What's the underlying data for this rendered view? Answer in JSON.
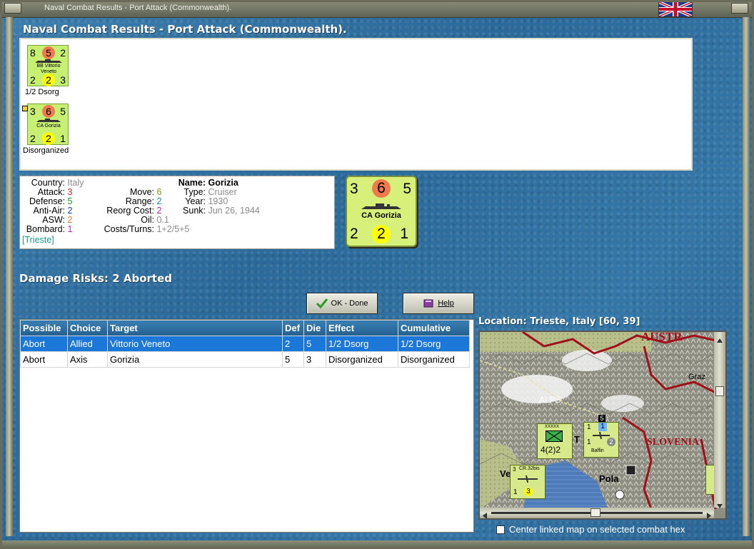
{
  "window": {
    "title": "Naval Combat Results - Port Attack (Commonwealth)."
  },
  "heading": "Naval Combat Results - Port Attack (Commonwealth).",
  "units": [
    {
      "attack_top_left": "8",
      "center_top": "5",
      "top_right": "2",
      "name_line1": "BB Vittorio",
      "name_line2": "Veneto",
      "bottom_left": "2",
      "center_bottom": "2",
      "bottom_right": "3",
      "status": "1/2 Dsorg"
    },
    {
      "attack_top_left": "3",
      "center_top": "6",
      "top_right": "5",
      "name_line1": "CA Gorizia",
      "name_line2": "",
      "bottom_left": "2",
      "center_bottom": "2",
      "bottom_right": "1",
      "status": "Disorganized"
    }
  ],
  "info": {
    "country_label": "Country:",
    "country": "Italy",
    "attack_label": "Attack:",
    "attack": "3",
    "defense_label": "Defense:",
    "defense": "5",
    "antiair_label": "Anti-Air:",
    "antiair": "2",
    "asw_label": "ASW:",
    "asw": "2",
    "bombard_label": "Bombard:",
    "bombard": "1",
    "location_link": "[Trieste]",
    "move_label": "Move:",
    "move": "6",
    "range_label": "Range:",
    "range": "2",
    "reorg_label": "Reorg Cost:",
    "reorg": "2",
    "oil_label": "Oil:",
    "oil": "0.1",
    "costs_label": "Costs/Turns:",
    "costs": "1+2/5+5",
    "name_label": "Name:",
    "name": "Gorizia",
    "type_label": "Type:",
    "type": "Cruiser",
    "year_label": "Year:",
    "year": "1930",
    "sunk_label": "Sunk:",
    "sunk": "Jun 26, 1944"
  },
  "big_counter": {
    "top_left": "3",
    "top_center": "6",
    "top_right": "5",
    "name": "CA Gorizia",
    "bottom_left": "2",
    "bottom_center": "2",
    "bottom_right": "1"
  },
  "damage_risks": "Damage Risks:  2 Aborted",
  "buttons": {
    "ok": "OK - Done",
    "help": "Help"
  },
  "table": {
    "headers": [
      "Possible",
      "Choice",
      "Target",
      "Def",
      "Die",
      "Effect",
      "Cumulative"
    ],
    "rows": [
      [
        "Abort",
        "Allied",
        "Vittorio Veneto",
        "2",
        "5",
        "1/2 Dsorg",
        "1/2 Dsorg"
      ],
      [
        "Abort",
        "Axis",
        "Gorizia",
        "5",
        "3",
        "Disorganized",
        "Disorganized"
      ]
    ]
  },
  "location": "Location:  Trieste, Italy [60, 39]",
  "map": {
    "labels": {
      "austria": "AUSTR",
      "graz": "Graz",
      "alps": "ALPS",
      "slovenia": "SLOVENIA",
      "pola": "Pola",
      "ve": "Ve",
      "t": "T"
    },
    "counters": {
      "infantry_size": "XXXXX",
      "infantry_strength": "4(2)2",
      "air_name": "Baffin",
      "air_top_left": "1",
      "air_top_mid": "1",
      "air_bottom_left": "1",
      "air_bottom_right": "2",
      "cr_name": "CR.32bis",
      "cr_top": "3",
      "cr_bottom_left": "1",
      "cr_bottom_mid": "3",
      "stack_count": "5"
    }
  },
  "checkbox_label": "Center linked map on selected combat hex",
  "colors": {
    "counter_green": "#c7ef72",
    "selected_row": "#1c78d8",
    "header_blue": "#2e6fa3"
  }
}
